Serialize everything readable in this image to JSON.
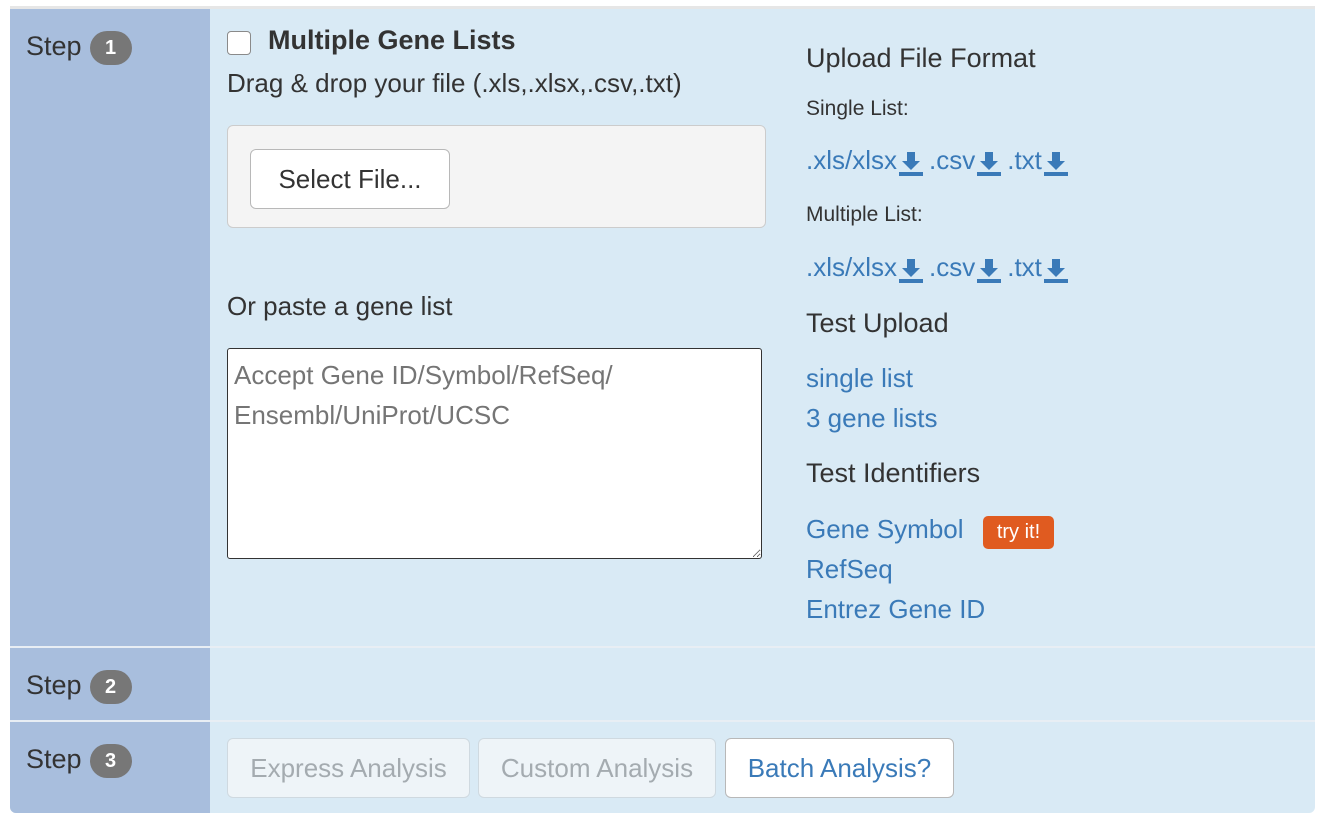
{
  "steps": [
    {
      "label": "Step",
      "num": "1"
    },
    {
      "label": "Step",
      "num": "2"
    },
    {
      "label": "Step",
      "num": "3"
    }
  ],
  "upload": {
    "multiple_label": "Multiple Gene Lists",
    "drag_text": "Drag & drop your file (.xls,.xlsx,.csv,.txt)",
    "select_button": "Select File...",
    "paste_label": "Or paste a gene list",
    "paste_placeholder": "Accept Gene ID/Symbol/RefSeq/\nEnsembl/UniProt/UCSC"
  },
  "format": {
    "title": "Upload File Format",
    "single_label": "Single List:",
    "multiple_label": "Multiple List:",
    "downloads": [
      ".xls/xlsx",
      ".csv",
      ".txt"
    ]
  },
  "test_upload": {
    "title": "Test Upload",
    "links": [
      "single list",
      "3 gene lists"
    ]
  },
  "test_identifiers": {
    "title": "Test Identifiers",
    "links": [
      "Gene Symbol",
      "RefSeq",
      "Entrez Gene ID"
    ],
    "badge": "try it!"
  },
  "analysis": {
    "express": "Express Analysis",
    "custom": "Custom Analysis",
    "batch": "Batch Analysis?"
  },
  "colors": {
    "accent_link": "#3a7ab8",
    "badge_orange": "#e05b20",
    "panel_bg": "#d9eaf5",
    "step_column": "#a8bedd"
  }
}
